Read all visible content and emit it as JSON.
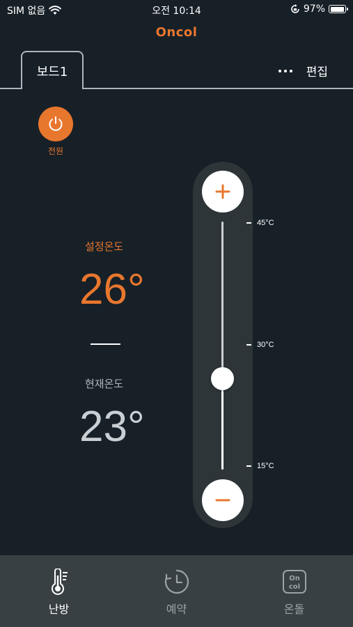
{
  "status_bar": {
    "carrier": "SIM 없음",
    "time": "오전 10:14",
    "battery": "97%",
    "battery_level": 0.97
  },
  "app": {
    "logo_text": "Oncol"
  },
  "tabs": {
    "active_label": "보드1",
    "edit_label": "편집"
  },
  "power": {
    "label": "전원"
  },
  "temperature": {
    "set_label": "설정온도",
    "set_value": "26°",
    "current_label": "현재온도",
    "current_value": "23°"
  },
  "slider": {
    "min": 15,
    "max": 45,
    "current": 26,
    "ticks": [
      "45°C",
      "30°C",
      "15°C"
    ]
  },
  "bottom_nav": {
    "items": [
      {
        "label": "난방",
        "icon": "thermometer-icon",
        "active": true
      },
      {
        "label": "예약",
        "icon": "clock-icon",
        "active": false
      },
      {
        "label": "온돌",
        "icon": "oncol-logo-icon",
        "active": false
      }
    ]
  },
  "colors": {
    "accent": "#e8772e",
    "background": "#172027",
    "nav_background": "#394044"
  }
}
